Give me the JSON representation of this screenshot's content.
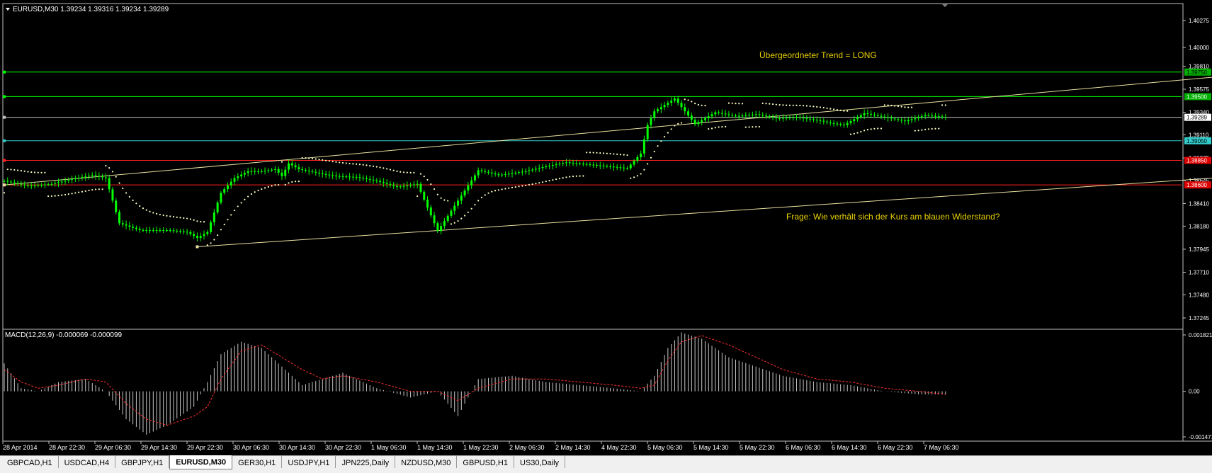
{
  "header": {
    "caption": "EURUSD,M30  1.39234 1.39316 1.39234 1.39289",
    "macd_caption": "MACD(12,26,9) -0.000069 -0.000099"
  },
  "annotations": {
    "trend": "Übergeordneter Trend = LONG",
    "question": "Frage: Wie verhält sich der Kurs am blauen Widerstand?"
  },
  "price_axis": {
    "ticks": [
      "1.40275",
      "1.40000",
      "1.39810",
      "1.39575",
      "1.39340",
      "1.39110",
      "1.38875",
      "1.38645",
      "1.38410",
      "1.38180",
      "1.37945",
      "1.37710",
      "1.37480",
      "1.37245"
    ]
  },
  "level_labels": [
    {
      "text": "1.39750",
      "bg": "#00b000",
      "fg": "#000000"
    },
    {
      "text": "1.39500",
      "bg": "#00b000",
      "fg": "#ffffff"
    },
    {
      "text": "1.39289",
      "bg": "#ffffff",
      "fg": "#000000"
    },
    {
      "text": "1.39050",
      "bg": "#33cccc",
      "fg": "#000000"
    },
    {
      "text": "1.38850",
      "bg": "#dd0000",
      "fg": "#ffffff"
    },
    {
      "text": "1.38600",
      "bg": "#dd0000",
      "fg": "#ffffff"
    }
  ],
  "macd_axis": {
    "ticks": [
      "0.001821",
      "0.00",
      "-0.001471"
    ]
  },
  "time_axis": {
    "labels": [
      "28 Apr 2014",
      "28 Apr 22:30",
      "29 Apr 06:30",
      "29 Apr 14:30",
      "29 Apr 22:30",
      "30 Apr 06:30",
      "30 Apr 14:30",
      "30 Apr 22:30",
      "1 May 06:30",
      "1 May 14:30",
      "1 May 22:30",
      "2 May 06:30",
      "2 May 14:30",
      "4 May 22:30",
      "5 May 06:30",
      "5 May 14:30",
      "5 May 22:30",
      "6 May 06:30",
      "6 May 14:30",
      "6 May 22:30",
      "7 May 06:30"
    ]
  },
  "tabs": [
    {
      "label": "GBPCAD,H1",
      "active": false
    },
    {
      "label": "USDCAD,H4",
      "active": false
    },
    {
      "label": "GBPJPY,H1",
      "active": false
    },
    {
      "label": "EURUSD,M30",
      "active": true
    },
    {
      "label": "GER30,H1",
      "active": false
    },
    {
      "label": "USDJPY,H1",
      "active": false
    },
    {
      "label": "JPN225,Daily",
      "active": false
    },
    {
      "label": "NZDUSD,M30",
      "active": false
    },
    {
      "label": "GBPUSD,H1",
      "active": false
    },
    {
      "label": "US30,Daily",
      "active": false
    }
  ],
  "colors": {
    "background": "#000000",
    "candles": "#00ff00",
    "grid_border": "#c0c0c0",
    "annotation_text": "#e8d200",
    "trendline": "#e8e0a0",
    "parabolic_sar": "#ffffc0",
    "macd_histogram": "#c8c8c8",
    "macd_signal": "#ff3030"
  },
  "chart_data": [
    {
      "type": "line",
      "title": "EURUSD,M30",
      "ylim": [
        1.37245,
        1.40275
      ],
      "horizontal_levels": [
        {
          "value": 1.3975,
          "color": "#00ff00"
        },
        {
          "value": 1.395,
          "color": "#00ff00"
        },
        {
          "value": 1.39289,
          "color": "#c0c0c0"
        },
        {
          "value": 1.3905,
          "color": "#33cccc"
        },
        {
          "value": 1.3885,
          "color": "#ff2020"
        },
        {
          "value": 1.386,
          "color": "#ff2020"
        }
      ],
      "series": [
        {
          "x": [
            0,
            7,
            14,
            20,
            26,
            30,
            34,
            40,
            48,
            54,
            57,
            60,
            64,
            68,
            72,
            76,
            80,
            82,
            84,
            87,
            90,
            94,
            98,
            104,
            110,
            116,
            122,
            128,
            134,
            140,
            146,
            150,
            154,
            160,
            166,
            172,
            178,
            184,
            188,
            190,
            192,
            198,
            204,
            210,
            216,
            222,
            228,
            234,
            240,
            244,
            248,
            254,
            260,
            266,
            272,
            278
          ],
          "y": [
            1.3864,
            1.3859,
            1.3861,
            1.3866,
            1.387,
            1.3867,
            1.3821,
            1.3814,
            1.3814,
            1.3812,
            1.3806,
            1.3812,
            1.3852,
            1.3867,
            1.3874,
            1.3874,
            1.3876,
            1.3869,
            1.3882,
            1.3876,
            1.3874,
            1.3871,
            1.3869,
            1.3868,
            1.3864,
            1.3858,
            1.3861,
            1.3813,
            1.3844,
            1.3875,
            1.387,
            1.3872,
            1.3874,
            1.3879,
            1.3883,
            1.3881,
            1.3879,
            1.3877,
            1.3892,
            1.3921,
            1.3935,
            1.3948,
            1.3922,
            1.3934,
            1.393,
            1.3932,
            1.3928,
            1.3929,
            1.3926,
            1.3923,
            1.3921,
            1.3933,
            1.3929,
            1.3925,
            1.3931,
            1.3929
          ]
        }
      ],
      "trendlines": [
        {
          "x": [
            0,
            400
          ],
          "y": [
            1.386,
            1.3983
          ]
        },
        {
          "x": [
            57,
            400
          ],
          "y": [
            1.3797,
            1.3877
          ]
        }
      ]
    },
    {
      "type": "bar",
      "title": "MACD(12,26,9)",
      "ylim": [
        -0.001471,
        0.001821
      ],
      "series": [
        {
          "name": "MACD",
          "x": [
            0,
            5,
            10,
            16,
            24,
            30,
            36,
            42,
            48,
            56,
            60,
            64,
            70,
            76,
            82,
            88,
            94,
            100,
            110,
            120,
            128,
            134,
            140,
            150,
            160,
            170,
            180,
            188,
            192,
            196,
            200,
            206,
            214,
            222,
            230,
            240,
            250,
            260,
            270,
            278
          ],
          "y": [
            0.0009,
            0.0001,
            0.0,
            0.0003,
            0.0004,
            0.0,
            -0.0009,
            -0.0014,
            -0.0011,
            -0.0005,
            0.0003,
            0.0012,
            0.0016,
            0.0014,
            0.0008,
            0.0002,
            0.0004,
            0.0006,
            0.0001,
            -0.0002,
            0.0,
            -0.0008,
            0.0004,
            0.0005,
            0.0003,
            0.0002,
            0.0001,
            0.0,
            0.0005,
            0.0014,
            0.0019,
            0.0017,
            0.0011,
            0.0008,
            0.0005,
            0.0003,
            0.0002,
            0.0,
            -0.0001,
            -0.0001
          ]
        },
        {
          "name": "Signal",
          "x": [
            0,
            5,
            10,
            16,
            24,
            30,
            36,
            42,
            48,
            56,
            60,
            64,
            70,
            76,
            82,
            88,
            94,
            100,
            110,
            120,
            128,
            134,
            140,
            150,
            160,
            170,
            180,
            188,
            192,
            196,
            200,
            206,
            214,
            222,
            230,
            240,
            250,
            260,
            270,
            278
          ],
          "y": [
            0.0007,
            0.0003,
            0.0001,
            0.0002,
            0.0004,
            0.0003,
            -0.0004,
            -0.0009,
            -0.0011,
            -0.0008,
            -0.0005,
            0.0004,
            0.0013,
            0.0015,
            0.0011,
            0.0007,
            0.0004,
            0.0005,
            0.0003,
            0.0,
            0.0,
            -0.0003,
            0.0001,
            0.0004,
            0.0004,
            0.0003,
            0.0002,
            0.0001,
            0.0002,
            0.001,
            0.0016,
            0.0018,
            0.0015,
            0.0011,
            0.0007,
            0.0004,
            0.0003,
            0.0001,
            0.0,
            -0.0001
          ]
        }
      ]
    }
  ]
}
